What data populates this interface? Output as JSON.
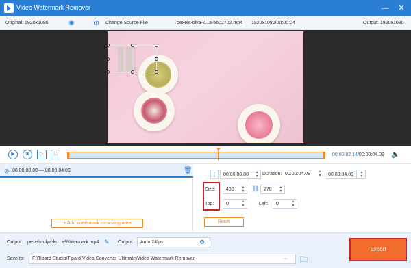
{
  "window": {
    "title": "Video Watermark Remover"
  },
  "infobar": {
    "original": "Original: 1920x1080",
    "change_source": "Change Source File",
    "filename": "pexels-olya-k...a-5602702.mp4",
    "file_meta": "1920x1080/00:00:04",
    "output": "Output: 1920x1080"
  },
  "player": {
    "current_time": "00:00:02.14",
    "total_time": "/00:00:04.09"
  },
  "segment": {
    "range": "00:00:00.00 — 00:00:04.09"
  },
  "left": {
    "add_button": "Add watermark removing area"
  },
  "right": {
    "start_time": "00:00:00.00",
    "duration_label": "Duration:",
    "duration": "00:00:04.09",
    "end_time": "00:00:04.09",
    "size_label": "Size:",
    "width": "480",
    "height": "270",
    "top_label": "Top:",
    "top": "0",
    "left_label": "Left:",
    "left": "0",
    "reset": "Reset"
  },
  "bottom": {
    "output_label": "Output:",
    "output_file": "pexels-olya-ko...eWatermark.mp4",
    "format_label": "Output:",
    "format": "Auto;24fps",
    "save_label": "Save to:",
    "save_path": "F:\\Tipard Studio\\Tipard Video Converter Ultimate\\Video Watermark Remover",
    "browse": "···",
    "export": "Export"
  },
  "colors": {
    "accent": "#2a7fd4",
    "orange": "#f08a24",
    "export": "#f26d2b",
    "highlight": "#c0262b"
  }
}
